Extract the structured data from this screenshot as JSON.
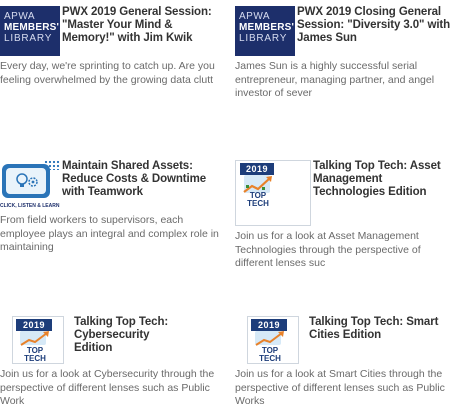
{
  "cards": [
    {
      "thumb": {
        "kind": "apwa",
        "line1": "APWA",
        "line2": "MEMBERS'",
        "line3": "LIBRARY"
      },
      "title": "PWX 2019 General Session: \"Master Your Mind & Memory!\" with Jim Kwik",
      "description": "Every day, we're sprinting to catch up. Are you feeling overwhelmed by the growing data clutt"
    },
    {
      "thumb": {
        "kind": "apwa",
        "line1": "APWA",
        "line2": "MEMBERS'",
        "line3": "LIBRARY"
      },
      "title": "PWX 2019 Closing General Session: \"Diversity 3.0\" with James Sun",
      "description": "James Sun is a highly successful serial entrepreneur, managing partner, and angel investor of sever"
    },
    {
      "thumb": {
        "kind": "click-listen-learn",
        "caption": "CLICK, LISTEN & LEARN"
      },
      "title": "Maintain Shared Assets: Reduce Costs & Downtime with Teamwork",
      "description": "From field workers to supervisors, each employee plays an integral and complex role in maintaining"
    },
    {
      "thumb": {
        "kind": "top-tech",
        "year": "2019",
        "word1": "TOP",
        "word2": "TECH"
      },
      "title": "Talking Top Tech: Asset Management Technologies Edition",
      "description": "Join us for a look at Asset Management Technologies through the perspective of different lenses suc"
    },
    {
      "thumb": {
        "kind": "top-tech",
        "year": "2019",
        "word1": "TOP",
        "word2": "TECH"
      },
      "title": "Talking Top Tech: Cybersecurity Edition",
      "description": "Join us for a look at Cybersecurity through the perspective of different lenses such as Public Work"
    },
    {
      "thumb": {
        "kind": "top-tech",
        "year": "2019",
        "word1": "TOP",
        "word2": "TECH"
      },
      "title": "Talking Top Tech: Smart Cities Edition",
      "description": "Join us for a look at Smart Cities through the perspective of different lenses such as Public Works"
    }
  ],
  "colors": {
    "apwa_navy": "#1d2f6b",
    "title_text": "#333333",
    "body_text": "#6a6a6a",
    "accent_blue": "#2a74b8"
  },
  "icons": [
    "lightbulb-gear-icon",
    "growth-arrow-icon"
  ]
}
